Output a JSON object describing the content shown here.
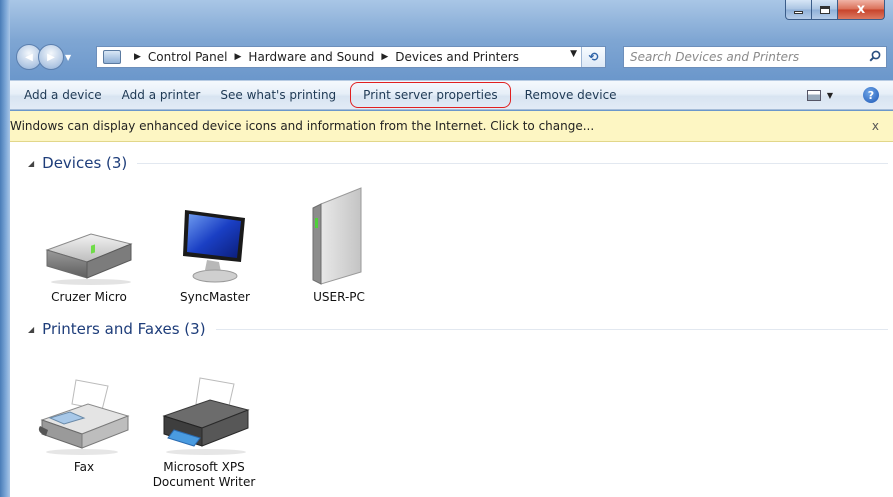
{
  "window": {
    "caption_buttons": [
      "minimize",
      "maximize",
      "close"
    ],
    "close_glyph": "x"
  },
  "nav": {
    "back_glyph": "◀",
    "forward_glyph": "▶",
    "breadcrumbs": [
      "Control Panel",
      "Hardware and Sound",
      "Devices and Printers"
    ],
    "breadcrumb_separator": "▶",
    "dropdown_glyph": "▼",
    "refresh_glyph": "⟲"
  },
  "search": {
    "placeholder": "Search Devices and Printers"
  },
  "toolbar": {
    "add_device": "Add a device",
    "add_printer": "Add a printer",
    "see_printing": "See what's printing",
    "print_server": "Print server properties",
    "remove_device": "Remove device",
    "view_drop_glyph": "▼",
    "help_glyph": "?"
  },
  "infobar": {
    "message": "Windows can display enhanced device icons and information from the Internet. Click to change...",
    "close_glyph": "x"
  },
  "groups": {
    "devices": {
      "title": "Devices (3)",
      "items": [
        {
          "label": "Cruzer Micro",
          "icon": "usb-drive-icon"
        },
        {
          "label": "SyncMaster",
          "icon": "monitor-icon"
        },
        {
          "label": "USER-PC",
          "icon": "computer-tower-icon"
        }
      ]
    },
    "printers": {
      "title": "Printers and Faxes (3)",
      "items": [
        {
          "label": "Fax",
          "icon": "fax-icon"
        },
        {
          "label": "Microsoft XPS\nDocument Writer",
          "label_line1": "Microsoft XPS",
          "label_line2": "Document Writer",
          "icon": "printer-icon"
        }
      ]
    },
    "collapse_glyph": "◢"
  },
  "colors": {
    "accent": "#1e3d7a",
    "infobar_bg": "#fdf6c3",
    "highlight_circle": "#e02020"
  }
}
